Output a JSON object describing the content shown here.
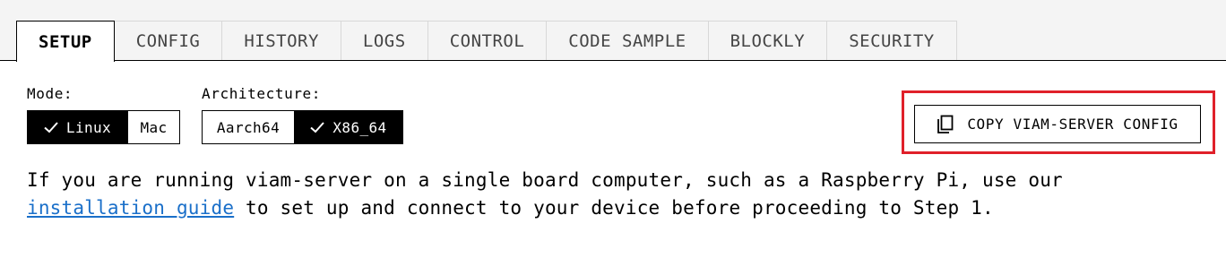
{
  "tabs": [
    "SETUP",
    "CONFIG",
    "HISTORY",
    "LOGS",
    "CONTROL",
    "CODE SAMPLE",
    "BLOCKLY",
    "SECURITY"
  ],
  "active_tab": "SETUP",
  "mode": {
    "label": "Mode:",
    "options": [
      "Linux",
      "Mac"
    ],
    "selected": "Linux"
  },
  "architecture": {
    "label": "Architecture:",
    "options": [
      "Aarch64",
      "X86_64"
    ],
    "selected": "X86_64"
  },
  "copy_button": {
    "label": "COPY VIAM-SERVER CONFIG",
    "icon": "copy-icon",
    "highlight_color": "#e0202a"
  },
  "instructions": {
    "before_link": "If you are running viam-server on a single board computer, such as a Raspberry Pi, use our ",
    "link_text": "installation guide",
    "after_link": " to set up and connect to your device before proceeding to Step 1."
  },
  "colors": {
    "link": "#1a6fc9",
    "selected_bg": "#000000"
  }
}
